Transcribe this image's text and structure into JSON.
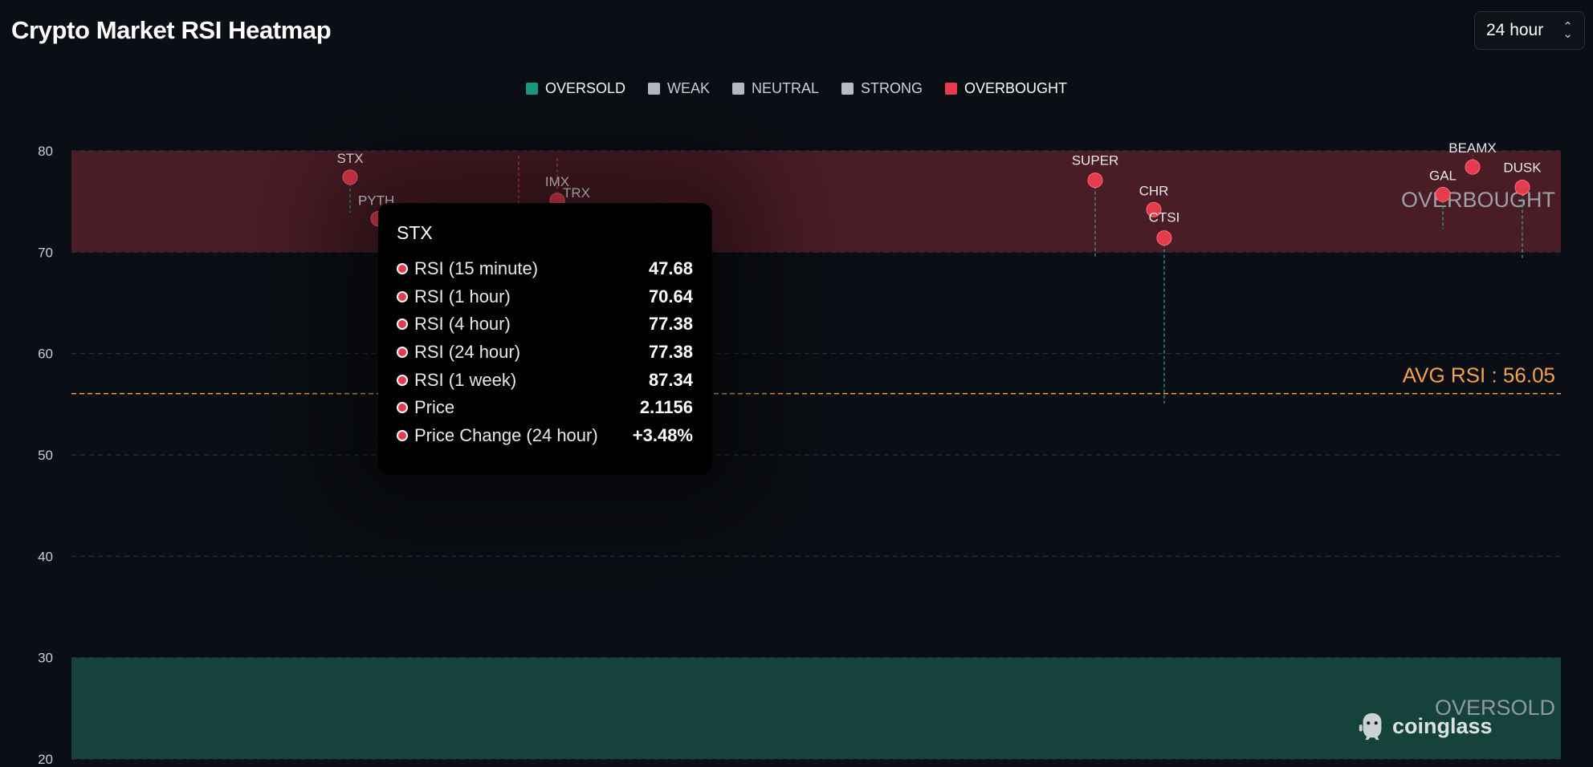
{
  "header": {
    "title": "Crypto Market RSI Heatmap",
    "timeframe": "24 hour"
  },
  "legend": [
    {
      "label": "OVERSOLD",
      "color": "#1a9c82",
      "active": true
    },
    {
      "label": "WEAK",
      "color": "#b8bcc4",
      "active": false
    },
    {
      "label": "NEUTRAL",
      "color": "#b8bcc4",
      "active": false
    },
    {
      "label": "STRONG",
      "color": "#b8bcc4",
      "active": false
    },
    {
      "label": "OVERBOUGHT",
      "color": "#e53b4c",
      "active": true
    }
  ],
  "chart_data": {
    "type": "scatter",
    "ylim": [
      20,
      80
    ],
    "yticks": [
      80,
      70,
      60,
      50,
      40,
      30,
      20
    ],
    "grid": true,
    "zones": [
      {
        "label": "OVERBOUGHT",
        "from": 70,
        "to": 80,
        "color": "#4a1c26"
      },
      {
        "label": "OVERSOLD",
        "from": 20,
        "to": 30,
        "color": "#16423c"
      }
    ],
    "avg_rsi": {
      "label": "AVG RSI : 56.05",
      "value": 56.05,
      "color": "#f2a24a"
    },
    "points": [
      {
        "name": "STX",
        "rsi": 77.4,
        "change_to": 73.9
      },
      {
        "name": "PYTH",
        "rsi": 73.3
      },
      {
        "name": "IMX",
        "rsi": 75.1,
        "change_to": 79.5
      },
      {
        "name": "TRX",
        "rsi": 75.1
      },
      {
        "name": "SUPER",
        "rsi": 77.1,
        "change_to": 69.4
      },
      {
        "name": "CHR",
        "rsi": 74.2
      },
      {
        "name": "CTSI",
        "rsi": 71.4,
        "change_to": 55.1
      },
      {
        "name": "GAL",
        "rsi": 75.7,
        "change_to": 72.3
      },
      {
        "name": "BEAMX",
        "rsi": 78.4,
        "change_to": 79.6
      },
      {
        "name": "DUSK",
        "rsi": 76.4,
        "change_to": 69.2
      }
    ],
    "hidden_segment": {
      "rsi_from": 79.5,
      "rsi_to": 74.6
    }
  },
  "tooltip": {
    "title": "STX",
    "rows": [
      {
        "label": "RSI (15 minute)",
        "value": "47.68"
      },
      {
        "label": "RSI (1 hour)",
        "value": "70.64"
      },
      {
        "label": "RSI (4 hour)",
        "value": "77.38"
      },
      {
        "label": "RSI (24 hour)",
        "value": "77.38"
      },
      {
        "label": "RSI (1 week)",
        "value": "87.34"
      },
      {
        "label": "Price",
        "value": "2.1156"
      },
      {
        "label": "Price Change (24 hour)",
        "value": "+3.48%"
      }
    ]
  },
  "watermark": {
    "text": "coinglass",
    "icon": "coinglass-logo-icon"
  }
}
